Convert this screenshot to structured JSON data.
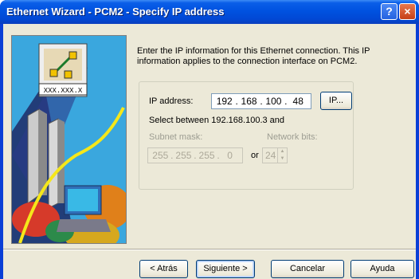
{
  "window": {
    "title": "Ethernet Wizard - PCM2 - Specify IP address",
    "help_glyph": "?",
    "close_glyph": "×"
  },
  "art": {
    "badge_text": "XXX.XXX.X"
  },
  "description": "Enter the IP information for this Ethernet connection. This IP information applies to the connection interface on PCM2.",
  "ip": {
    "label": "IP address:",
    "octets": [
      "192",
      "168",
      "100",
      "48"
    ],
    "button": "IP...",
    "range_text": "Select between 192.168.100.3 and"
  },
  "subnet": {
    "label": "Subnet mask:",
    "octets": [
      "255",
      "255",
      "255",
      "0"
    ],
    "or_text": "or"
  },
  "network_bits": {
    "label": "Network bits:",
    "value": "24"
  },
  "footer": {
    "back_label": "< Atrás",
    "next_label": "Siguiente >",
    "cancel_label": "Cancelar",
    "help_label": "Ayuda"
  },
  "colors": {
    "titlebar": "#0052e0",
    "dialog_bg": "#ece9d8",
    "button_border": "#003c74"
  }
}
